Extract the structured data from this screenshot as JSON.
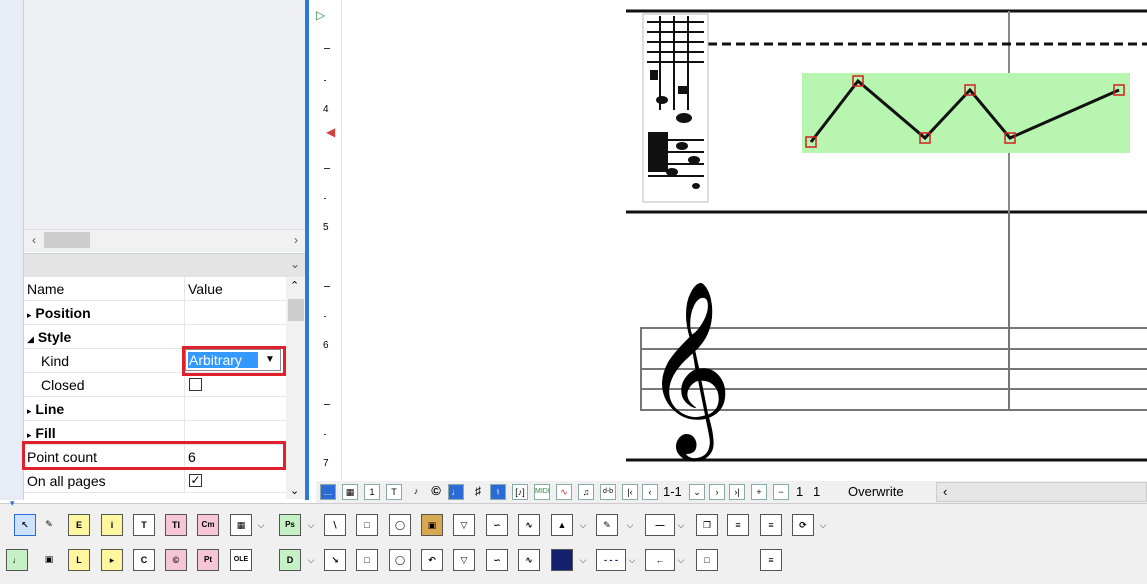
{
  "properties": {
    "header_name": "Name",
    "header_value": "Value",
    "rows": [
      {
        "name": "Position",
        "value": "",
        "kind": "group-collapsed"
      },
      {
        "name": "Style",
        "value": "",
        "kind": "group-expanded"
      },
      {
        "name": "Kind",
        "value": "Arbitrary",
        "kind": "dropdown"
      },
      {
        "name": "Closed",
        "value": "",
        "kind": "checkbox"
      },
      {
        "name": "Line",
        "value": "",
        "kind": "group-collapsed"
      },
      {
        "name": "Fill",
        "value": "",
        "kind": "group-collapsed"
      },
      {
        "name": "Point count",
        "value": "6",
        "kind": "text"
      },
      {
        "name": "On all pages",
        "value": "",
        "kind": "checkbox"
      }
    ],
    "closed_checked": false,
    "on_all_pages_checked": true
  },
  "ruler": {
    "numbers": [
      "4",
      "5",
      "6",
      "7"
    ]
  },
  "status": {
    "range": "1-1",
    "page_a": "1",
    "page_b": "1",
    "mode": "Overwrite",
    "icon_labels": [
      "T",
      "MIDI",
      "d-b"
    ]
  },
  "toolbar": {
    "row1_labels": [
      "E",
      "i",
      "T",
      "TI",
      "Cm",
      "Ps"
    ],
    "row2_labels": [
      "L",
      "C",
      "Pt",
      "OLE",
      "D"
    ]
  },
  "colors": {
    "accent": "#2b7bd6",
    "highlight": "#e0202a",
    "polyline_fill": "#b7f5b0",
    "selection": "#3399ff"
  }
}
